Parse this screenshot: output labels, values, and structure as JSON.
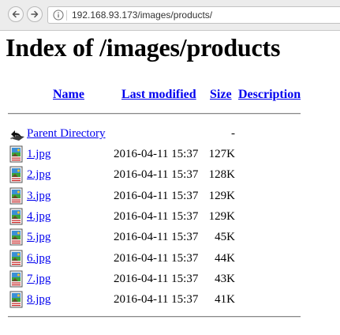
{
  "browser": {
    "url": "192.168.93.173/images/products/"
  },
  "page": {
    "title": "Index of /images/products"
  },
  "table": {
    "headers": {
      "name": "Name",
      "last_modified": "Last modified",
      "size": "Size",
      "description": "Description"
    },
    "parent": {
      "label": "Parent Directory",
      "size": "-"
    },
    "rows": [
      {
        "name": "1.jpg",
        "modified": "2016-04-11 15:37",
        "size": "127K"
      },
      {
        "name": "2.jpg",
        "modified": "2016-04-11 15:37",
        "size": "128K"
      },
      {
        "name": "3.jpg",
        "modified": "2016-04-11 15:37",
        "size": "129K"
      },
      {
        "name": "4.jpg",
        "modified": "2016-04-11 15:37",
        "size": "129K"
      },
      {
        "name": "5.jpg",
        "modified": "2016-04-11 15:37",
        "size": "45K"
      },
      {
        "name": "6.jpg",
        "modified": "2016-04-11 15:37",
        "size": "44K"
      },
      {
        "name": "7.jpg",
        "modified": "2016-04-11 15:37",
        "size": "43K"
      },
      {
        "name": "8.jpg",
        "modified": "2016-04-11 15:37",
        "size": "41K"
      }
    ]
  },
  "icons": {
    "back": "back-arrow-icon",
    "forward": "forward-arrow-icon",
    "site_info": "info-icon",
    "parent": "back-folder-icon",
    "file": "image-file-icon"
  },
  "colors": {
    "link": "#0000ee",
    "toolbar": "#ececec"
  }
}
